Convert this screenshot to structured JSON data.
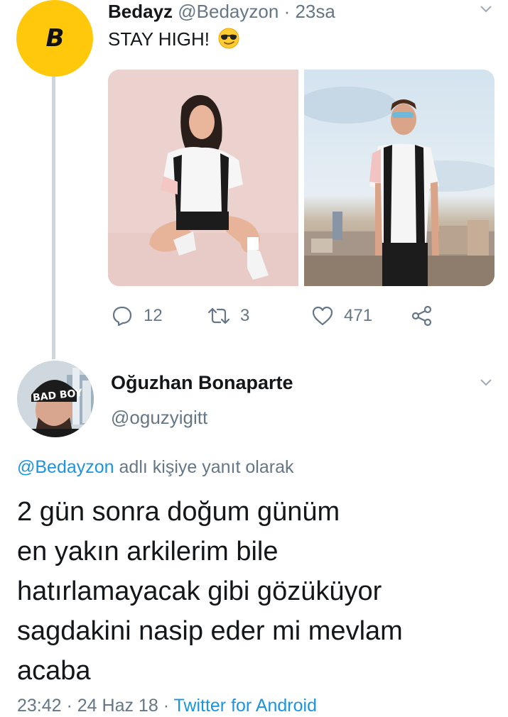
{
  "parent_tweet": {
    "avatar_glyph": "B",
    "display_name": "Bedayz",
    "handle": "@Bedayzon",
    "separator": "·",
    "time": "23sa",
    "text": "STAY HIGH!",
    "text_emoji": "smiling-face-with-sunglasses-emoji",
    "actions": {
      "replies": "12",
      "retweets": "3",
      "likes": "471"
    },
    "colors": {
      "avatar_bg": "#ffc80a"
    }
  },
  "reply_tweet": {
    "display_name": "Oğuzhan Bonaparte",
    "handle": "@oguzyigitt",
    "reply_to_handle": "@Bedayzon",
    "reply_to_suffix": "adlı kişiye yanıt olarak",
    "text_lines": [
      "2 gün sonra doğum günüm",
      "en yakın arkilerim bile",
      "hatırlamayacak gibi gözüküyor",
      "sagdakini nasip eder mi mevlam",
      "acaba"
    ],
    "footer_meta": "23:42 · 24 Haz 18 · ",
    "footer_source": "Twitter for Android"
  },
  "colors": {
    "link": "#1b95e0",
    "secondary_text": "#657786",
    "thread_line": "#ccd6dd"
  }
}
